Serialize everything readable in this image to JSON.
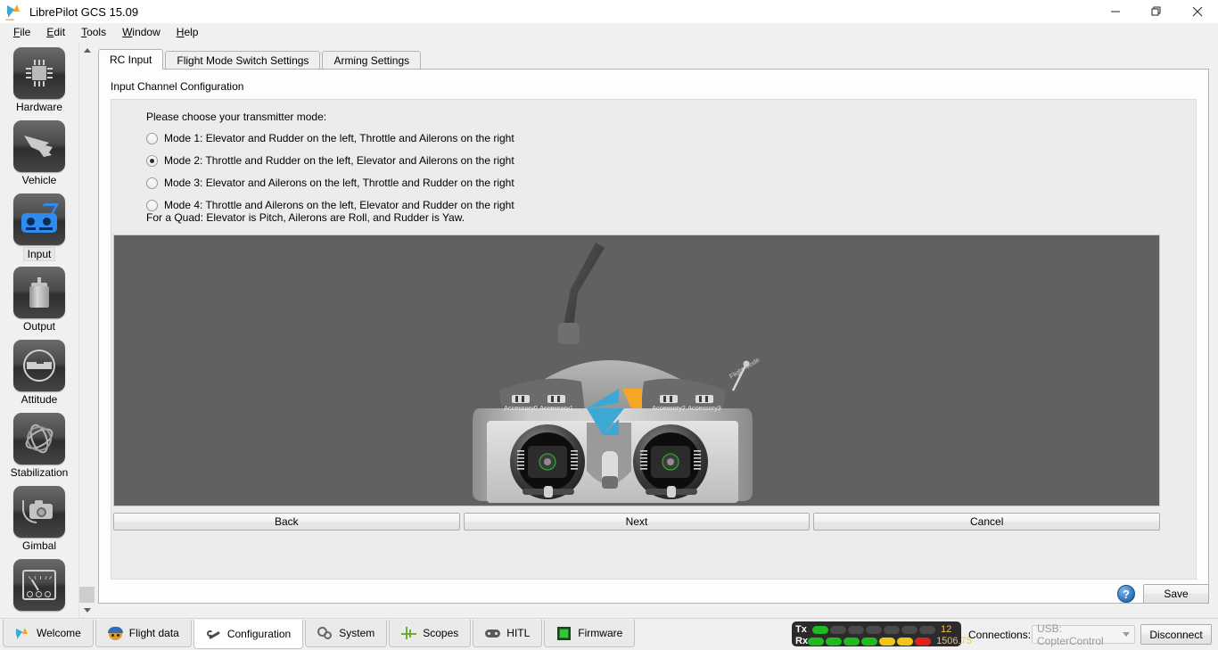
{
  "window": {
    "title": "LibrePilot GCS 15.09",
    "icon": "librepilot-bird-icon",
    "minimize_label": "Minimize",
    "maximize_label": "Restore",
    "close_label": "Close"
  },
  "menubar": {
    "items": [
      {
        "label": "File",
        "mnemonic": "F"
      },
      {
        "label": "Edit",
        "mnemonic": "E"
      },
      {
        "label": "Tools",
        "mnemonic": "T"
      },
      {
        "label": "Window",
        "mnemonic": "W"
      },
      {
        "label": "Help",
        "mnemonic": "H"
      }
    ]
  },
  "sidebar": {
    "items": [
      {
        "label": "Hardware",
        "icon": "chip-icon",
        "selected": false
      },
      {
        "label": "Vehicle",
        "icon": "aircraft-icon",
        "selected": false
      },
      {
        "label": "Input",
        "icon": "transmitter-icon",
        "selected": true
      },
      {
        "label": "Output",
        "icon": "motor-icon",
        "selected": false
      },
      {
        "label": "Attitude",
        "icon": "level-icon",
        "selected": false
      },
      {
        "label": "Stabilization",
        "icon": "gyro-icon",
        "selected": false
      },
      {
        "label": "Gimbal",
        "icon": "camera-icon",
        "selected": false
      },
      {
        "label": "",
        "icon": "gauge-icon",
        "selected": false
      }
    ],
    "scrollbar": {
      "up_arrow": "chevron-up-icon",
      "down_arrow": "chevron-down-icon"
    }
  },
  "main": {
    "tabs": [
      {
        "label": "RC Input",
        "active": true
      },
      {
        "label": "Flight Mode Switch Settings",
        "active": false
      },
      {
        "label": "Arming Settings",
        "active": false
      }
    ],
    "panel_title": "Input Channel Configuration",
    "prompt": "Please choose your transmitter mode:",
    "modes": [
      {
        "label": "Mode 1: Elevator and Rudder on the left, Throttle and Ailerons on the right",
        "checked": false
      },
      {
        "label": "Mode 2: Throttle and Rudder on the left, Elevator and Ailerons on the right",
        "checked": true
      },
      {
        "label": "Mode 3: Elevator and Ailerons on the left, Throttle and Rudder on the right",
        "checked": false
      },
      {
        "label": "Mode 4: Throttle and Ailerons on the left, Elevator and Rudder on the right",
        "checked": false
      }
    ],
    "quad_note": "For a Quad: Elevator is Pitch, Ailerons are Roll, and Rudder is Yaw.",
    "transmitter_image": {
      "background_color": "#616161",
      "accessory_labels": [
        "Accessory0",
        "Accessory1",
        "Accessory2",
        "Accessory3"
      ],
      "flight_mode_label": "Flight Mode",
      "logo": "librepilot-bird-logo"
    },
    "wizard_buttons": [
      {
        "label": "Back",
        "name": "back-button"
      },
      {
        "label": "Next",
        "name": "next-button"
      },
      {
        "label": "Cancel",
        "name": "cancel-button"
      }
    ],
    "help_label": "?",
    "save_label": "Save"
  },
  "taskbar": {
    "tabs": [
      {
        "label": "Welcome",
        "icon": "bird-icon",
        "active": false
      },
      {
        "label": "Flight data",
        "icon": "pilot-icon",
        "active": false
      },
      {
        "label": "Configuration",
        "icon": "wrench-icon",
        "active": true
      },
      {
        "label": "System",
        "icon": "gears-icon",
        "active": false
      },
      {
        "label": "Scopes",
        "icon": "waveform-icon",
        "active": false
      },
      {
        "label": "HITL",
        "icon": "gamepad-icon",
        "active": false
      },
      {
        "label": "Firmware",
        "icon": "chip-green-icon",
        "active": false
      }
    ]
  },
  "status": {
    "tx_label": "Tx",
    "rx_label": "Rx",
    "tx_leds": [
      "green",
      "off",
      "off",
      "off",
      "off",
      "off",
      "off"
    ],
    "rx_leds": [
      "green",
      "green",
      "green",
      "green",
      "yellow",
      "yellow",
      "red"
    ],
    "tx_value": "12",
    "rx_value": "1506.75",
    "led_colors": {
      "green": "#1fbb1f",
      "yellow": "#f3c51a",
      "red": "#e32020",
      "off": "#4a4a4a"
    },
    "connections_label": "Connections:",
    "connection_selected": "USB: CopterControl",
    "disconnect_label": "Disconnect"
  }
}
